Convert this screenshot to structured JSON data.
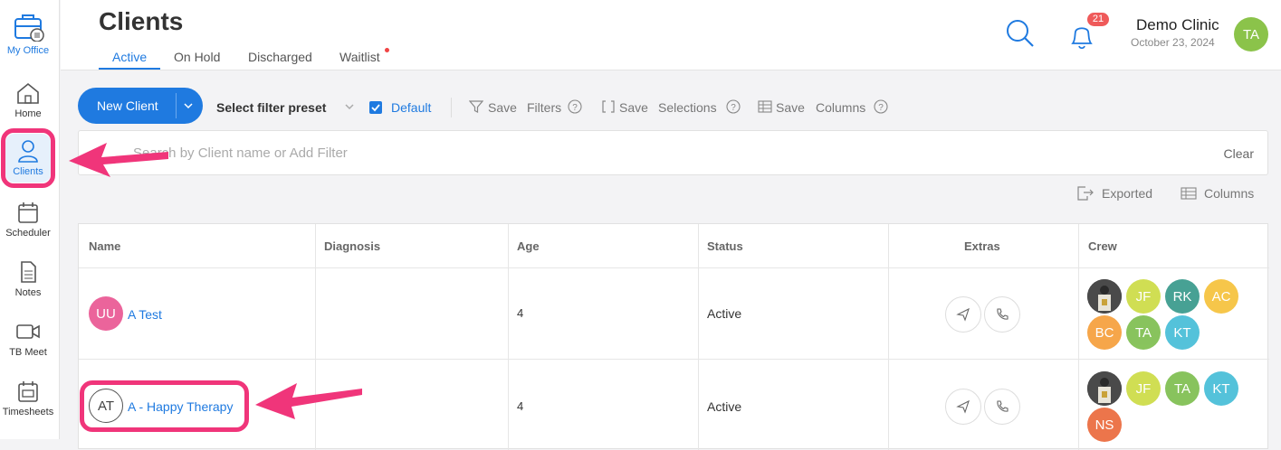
{
  "sidebar": {
    "brand": "My Office",
    "items": [
      {
        "label": "Home"
      },
      {
        "label": "Clients"
      },
      {
        "label": "Scheduler"
      },
      {
        "label": "Notes"
      },
      {
        "label": "TB Meet"
      },
      {
        "label": "Timesheets"
      }
    ]
  },
  "header": {
    "title": "Clients",
    "tabs": [
      {
        "label": "Active"
      },
      {
        "label": "On Hold"
      },
      {
        "label": "Discharged"
      },
      {
        "label": "Waitlist"
      }
    ],
    "notifications_count": "21",
    "org_name": "Demo Clinic",
    "date": "October 23, 2024",
    "user_initials": "TA"
  },
  "toolbar": {
    "new_client": "New Client",
    "filter_preset": "Select filter preset",
    "default_label": "Default",
    "save1": "Save",
    "filters": "Filters",
    "save2": "Save",
    "selections": "Selections",
    "save3": "Save",
    "columns": "Columns"
  },
  "search": {
    "placeholder": "Search by Client name or Add Filter",
    "clear": "Clear"
  },
  "actions": {
    "exported": "Exported",
    "columns": "Columns"
  },
  "table": {
    "headers": [
      "Name",
      "Diagnosis",
      "Age",
      "Status",
      "Extras",
      "Crew"
    ],
    "rows": [
      {
        "initials": "UU",
        "name": "A Test",
        "diagnosis": "",
        "age": "4",
        "status": "Active",
        "crew": [
          "",
          "JF",
          "RK",
          "AC",
          "BC",
          "TA",
          "KT"
        ]
      },
      {
        "initials": "AT",
        "name": "A - Happy Therapy",
        "diagnosis": "",
        "age": "4",
        "status": "Active",
        "crew": [
          "",
          "JF",
          "TA",
          "KT",
          "NS"
        ]
      }
    ]
  },
  "colors": {
    "accent": "#1f7ae0",
    "highlight": "#f0357a",
    "crew_jf": "#c5d629",
    "crew_rk": "#1a8a7a",
    "crew_ac": "#f4b81d",
    "crew_bc": "#f4901d",
    "crew_ta": "#6bb535",
    "crew_kt": "#2ab3d1",
    "crew_ns": "#e8531f"
  }
}
